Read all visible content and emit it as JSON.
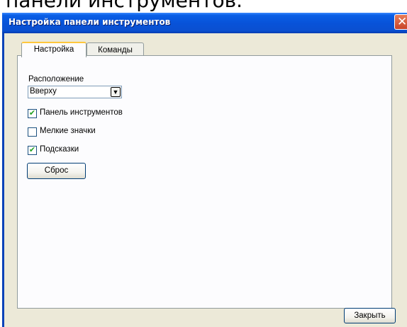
{
  "background_text": "панели инструментов.",
  "window": {
    "title": "Настройка панели инструментов",
    "close_glyph": "✕"
  },
  "tabs": [
    {
      "label": "Настройка",
      "active": true
    },
    {
      "label": "Команды",
      "active": false
    }
  ],
  "settings": {
    "location_label": "Расположение",
    "location_select": {
      "value": "Вверху",
      "arrow": "▼"
    },
    "checkboxes": [
      {
        "label": "Панель инструментов",
        "checked": true,
        "mark": "✔"
      },
      {
        "label": "Мелкие значки",
        "checked": false,
        "mark": ""
      },
      {
        "label": "Подсказки",
        "checked": true,
        "mark": "✔"
      }
    ],
    "reset_label": "Сброс"
  },
  "footer": {
    "close_label": "Закрыть"
  },
  "colors": {
    "title_bar": "#0853d9",
    "dialog_bg": "#ece9d8",
    "active_tab_accent": "#ffc73c",
    "close_button": "#c8442a",
    "check_mark": "#21a121"
  }
}
